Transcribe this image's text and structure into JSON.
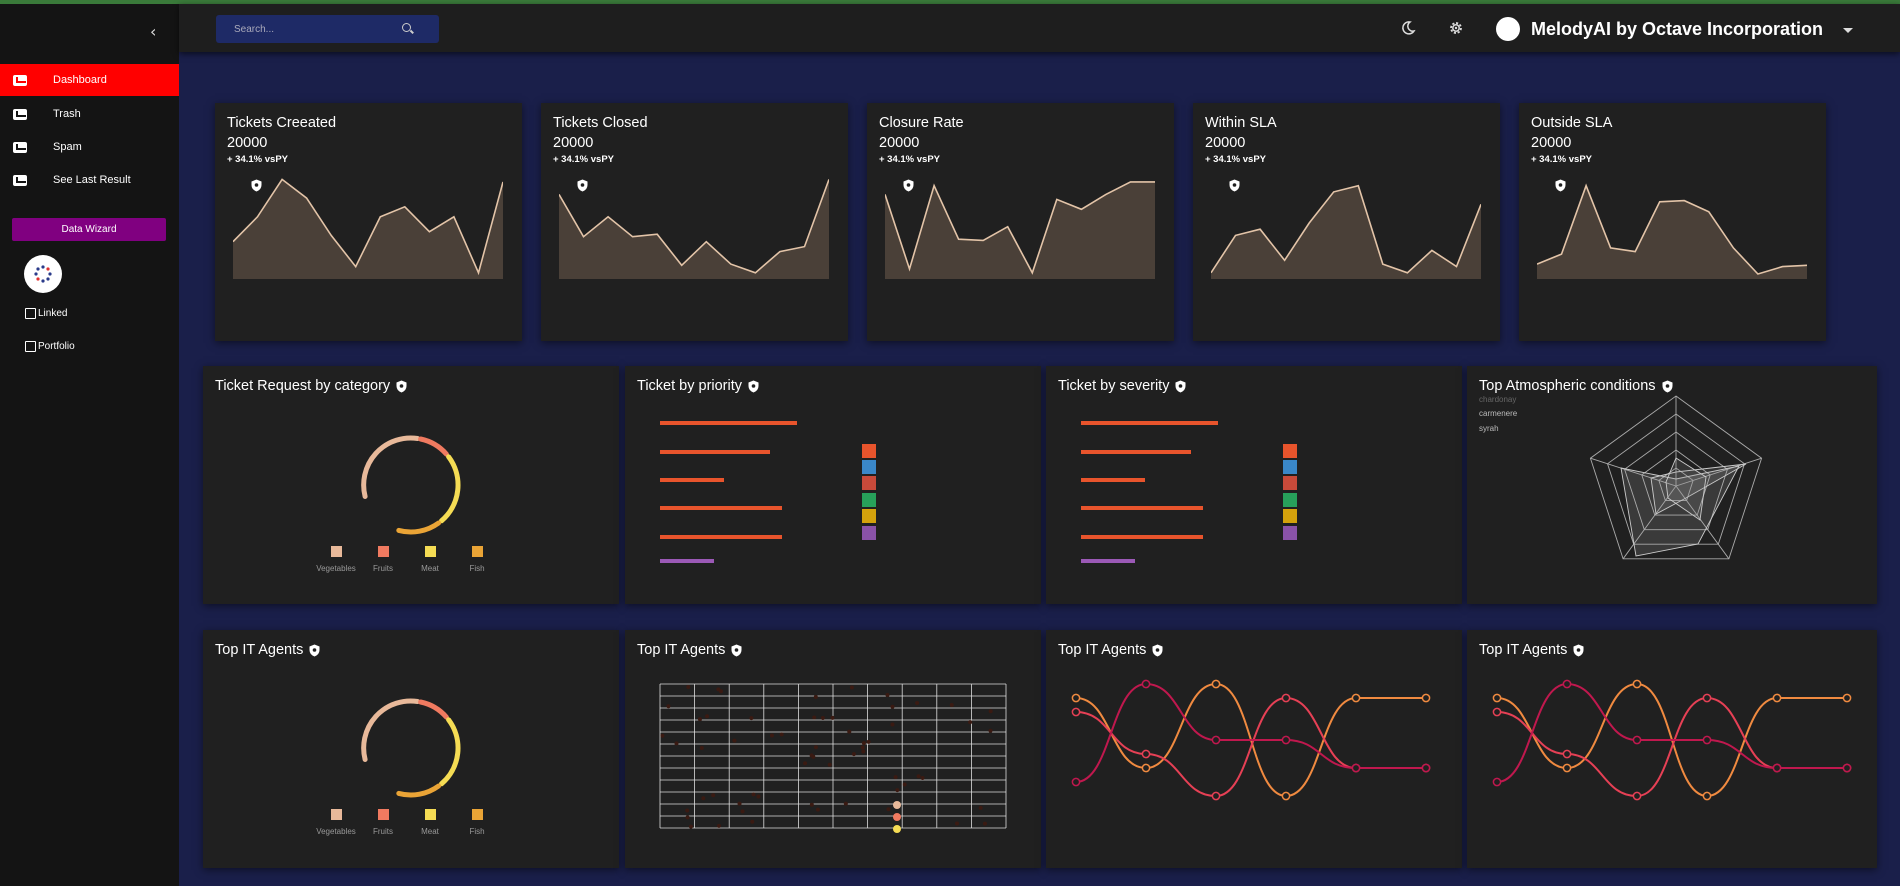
{
  "sidebar": {
    "collapse_icon": "chevron-left-icon",
    "items": [
      {
        "label": "Dashboard",
        "icon": "inbox-icon",
        "active": true
      },
      {
        "label": "Trash",
        "icon": "mail-icon",
        "active": false
      },
      {
        "label": "Spam",
        "icon": "inbox-icon",
        "active": false
      },
      {
        "label": "See Last Result",
        "icon": "mail-icon",
        "active": false
      }
    ],
    "wizard_label": "Data Wizard",
    "links": [
      {
        "label": "Linked",
        "icon": "linkedin-icon"
      },
      {
        "label": "Portfolio",
        "icon": "building-icon"
      }
    ]
  },
  "topbar": {
    "search_placeholder": "Search...",
    "brand": "MelodyAI by Octave Incorporation",
    "icons": [
      "moon-icon",
      "gear-icon",
      "chevron-down-icon"
    ]
  },
  "kpis": [
    {
      "title": "Tickets Creeated",
      "value": "20000",
      "delta": "+ 34.1% vsPY",
      "trend": [
        3,
        5,
        8,
        6.5,
        3.5,
        1,
        5,
        5.8,
        3.8,
        5,
        0.5,
        7.8
      ]
    },
    {
      "title": "Tickets Closed",
      "value": "20000",
      "delta": "+ 34.1% vsPY",
      "trend": [
        6.8,
        3.4,
        5,
        3.4,
        3.6,
        1.1,
        3,
        1.2,
        0.5,
        2.2,
        2.6,
        8
      ]
    },
    {
      "title": "Closure Rate",
      "value": "20000",
      "delta": "+ 34.1% vsPY",
      "trend": [
        6.8,
        0.8,
        7.5,
        3.2,
        3.1,
        4.2,
        0.5,
        6.4,
        5.6,
        6.8,
        7.8,
        7.8
      ]
    },
    {
      "title": "Within SLA",
      "value": "20000",
      "delta": "+ 34.1% vsPY",
      "trend": [
        0.5,
        3.5,
        4,
        1.5,
        4.5,
        7,
        7.5,
        1.2,
        0.5,
        2.3,
        1,
        6
      ]
    },
    {
      "title": "Outside SLA",
      "value": "20000",
      "delta": "+ 34.1% vsPY",
      "trend": [
        1.2,
        2,
        7.5,
        2.5,
        2.2,
        6.2,
        6.3,
        5.4,
        2.5,
        0.4,
        1,
        1.1
      ]
    }
  ],
  "panels": {
    "category": {
      "title": "Ticket Request by category",
      "legend": [
        "Vegetables",
        "Fruits",
        "Meat",
        "Fish"
      ]
    },
    "priority": {
      "title": "Ticket by priority"
    },
    "severity": {
      "title": "Ticket by severity"
    },
    "atmos": {
      "title": "Top Atmospheric conditions",
      "labels": [
        "chardonay",
        "carmenere",
        "syrah"
      ]
    },
    "agents1": {
      "title": "Top IT Agents",
      "legend": [
        "Vegetables",
        "Fruits",
        "Meat",
        "Fish"
      ]
    },
    "agents2": {
      "title": "Top IT Agents"
    },
    "agents3": {
      "title": "Top IT Agents"
    },
    "agents4": {
      "title": "Top IT Agents"
    }
  },
  "colors": {
    "active_nav": "#ff0000",
    "wizard": "#800080",
    "search_bg": "#1e2a66",
    "bar": "#e8542c",
    "bar_last": "#9b59b6",
    "area_stroke": "#e3c4a8",
    "area_fill": "#4a4038",
    "legend": [
      "#e8542c",
      "#3a87c8",
      "#c84a3a",
      "#27a05a",
      "#d4a20c",
      "#8a52a8"
    ],
    "donut": [
      "#e8b99a",
      "#f07a60",
      "#f5dc54",
      "#eaa436"
    ],
    "bump": [
      "#f08a40",
      "#e64055",
      "#c0184e"
    ]
  }
}
